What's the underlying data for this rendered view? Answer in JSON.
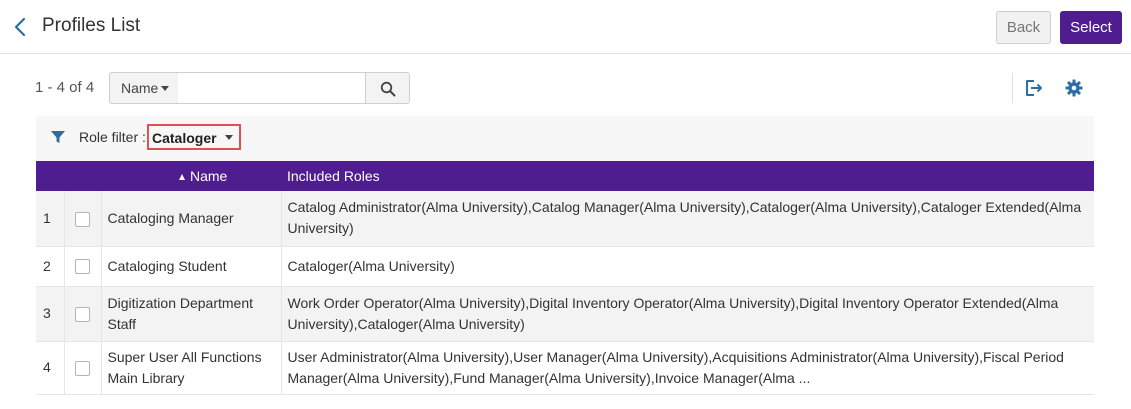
{
  "header": {
    "title": "Profiles List",
    "back_button": "Back",
    "select_button": "Select"
  },
  "toolbar": {
    "count": "1 - 4 of 4",
    "search_field": "Name",
    "search_value": "",
    "icons": [
      "search-icon",
      "export-icon",
      "gear-icon"
    ]
  },
  "filter": {
    "label": "Role filter :",
    "value": "Cataloger"
  },
  "table": {
    "columns": [
      "Name",
      "Included Roles"
    ],
    "sort": "Name ascending",
    "rows": [
      {
        "index": "1",
        "name": "Cataloging Manager",
        "roles": "Catalog Administrator(Alma University),Catalog Manager(Alma University),Cataloger(Alma University),Cataloger Extended(Alma University)"
      },
      {
        "index": "2",
        "name": "Cataloging Student",
        "roles": "Cataloger(Alma University)"
      },
      {
        "index": "3",
        "name": "Digitization Department Staff",
        "roles": "Work Order Operator(Alma University),Digital Inventory Operator(Alma University),Digital Inventory Operator Extended(Alma University),Cataloger(Alma University)"
      },
      {
        "index": "4",
        "name": "Super User All Functions Main Library",
        "roles": "User Administrator(Alma University),User Manager(Alma University),Acquisitions Administrator(Alma University),Fiscal Period Manager(Alma University),Fund Manager(Alma University),Invoice Manager(Alma ..."
      }
    ]
  },
  "colors": {
    "brand": "#4f1d8f",
    "accent": "#2e6da4",
    "highlight": "#e05252"
  }
}
